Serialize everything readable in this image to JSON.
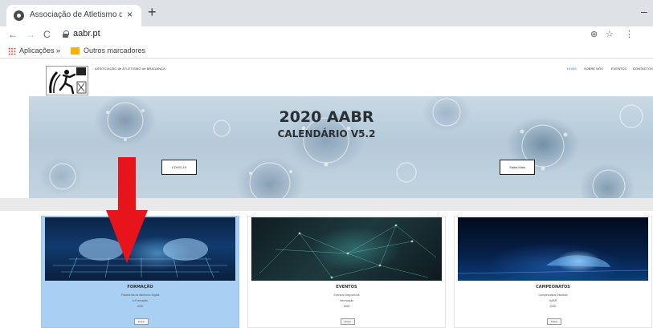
{
  "browser": {
    "tab_title": "Associação de Atletismo de Bragança",
    "tab_close": "×",
    "new_tab": "+",
    "window_minimize": "–",
    "nav": {
      "back": "←",
      "forward": "→",
      "reload": "C"
    },
    "url": "aabr.pt",
    "toolbar_icons": {
      "zoom": "⊕",
      "star": "☆",
      "menu": "⋮"
    },
    "bookmarks": {
      "apps_label": "Aplicações",
      "more": "»",
      "folder_label": "Outros marcadores"
    }
  },
  "site": {
    "logo_text": "ASSOCIAÇÃO de ATLETISMO de BRAGANÇA",
    "nav": [
      "HOME",
      "SOBRE NÓS",
      "EVENTOS",
      "CONTACTOS"
    ],
    "hero": {
      "title": "2020 AABR",
      "subtitle": "CALENDÁRIO V5.2",
      "btn_left": "COVID-19",
      "btn_right": "Saiba Mais"
    },
    "cards": [
      {
        "title": "FORMAÇÃO",
        "lines": [
          "Plataforma de Atletismo Digital",
          "e-Formação",
          "2020"
        ],
        "button": "Entrar"
      },
      {
        "title": "EVENTOS",
        "lines": [
          "Eventos Desportivos",
          "Informação",
          "2020"
        ],
        "button": "Entrar"
      },
      {
        "title": "CAMPEONATOS",
        "lines": [
          "Campeonatos Distritais",
          "AABR",
          "2020"
        ],
        "button": "Entrar"
      }
    ]
  },
  "colors": {
    "active_card": "#a9d0f2",
    "arrow": "#e8141c",
    "nav_active": "#3f84d2"
  }
}
